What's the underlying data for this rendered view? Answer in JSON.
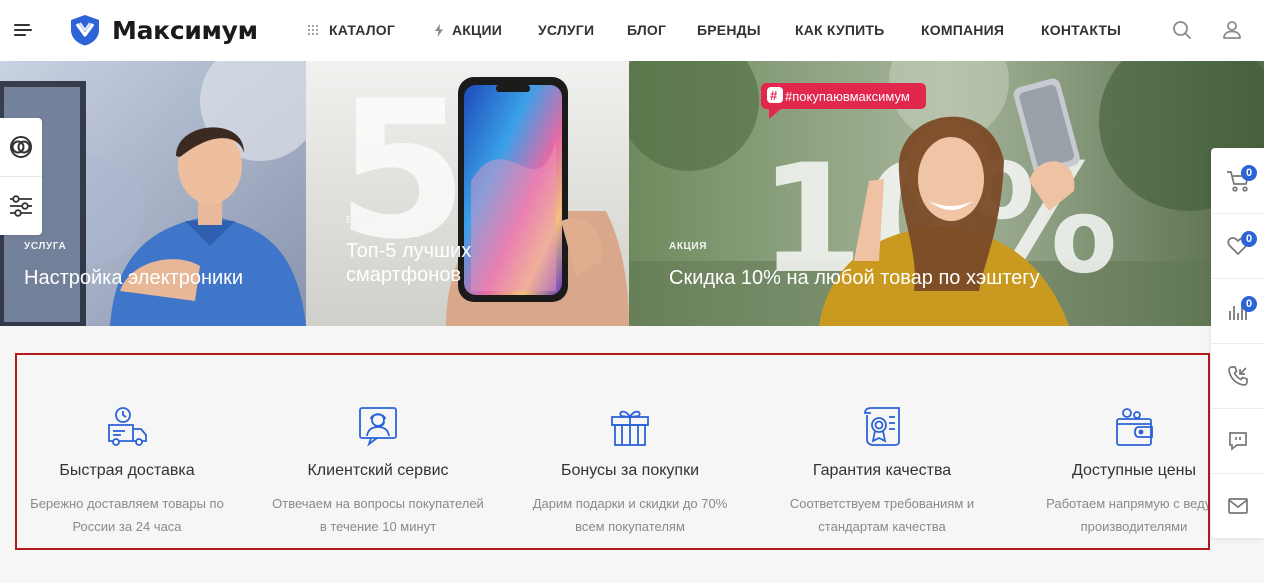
{
  "brand": {
    "name": "Максимум",
    "accent": "#2c63d6"
  },
  "nav": {
    "items": [
      {
        "label": "КАТАЛОГ",
        "icon": "grid-icon"
      },
      {
        "label": "АКЦИИ",
        "icon": "lightning-icon"
      },
      {
        "label": "УСЛУГИ"
      },
      {
        "label": "БЛОГ"
      },
      {
        "label": "БРЕНДЫ"
      },
      {
        "label": "КАК КУПИТЬ"
      },
      {
        "label": "КОМПАНИЯ"
      },
      {
        "label": "КОНТАКТЫ"
      }
    ]
  },
  "banners": [
    {
      "tag": "УСЛУГА",
      "title": "Настройка электроники"
    },
    {
      "tag": "БЛОГ",
      "title": "Топ-5 лучших смартфонов",
      "line1": "Топ-5 лучших",
      "line2": "смартфонов",
      "big_text": "5"
    },
    {
      "tag": "АКЦИЯ",
      "title": "Скидка 10% на любой товар по хэштегу",
      "hashtag": "#покупаювмаксимум",
      "big_text": "10%"
    }
  ],
  "right_panel": {
    "cart_count": "0",
    "favorites_count": "0",
    "compare_count": "0"
  },
  "features": [
    {
      "title": "Быстрая доставка",
      "desc_line1": "Бережно доставляем товары по",
      "desc_line2": "России за 24 часа",
      "icon": "delivery-truck-icon"
    },
    {
      "title": "Клиентский сервис",
      "desc_line1": "Отвечаем на вопросы покупателей",
      "desc_line2": "в течение 10 минут",
      "icon": "support-agent-icon"
    },
    {
      "title": "Бонусы за покупки",
      "desc_line1": "Дарим подарки и скидки до 70%",
      "desc_line2": "всем покупателям",
      "icon": "gift-icon"
    },
    {
      "title": "Гарантия качества",
      "desc_line1": "Соответствуем требованиям и",
      "desc_line2": "стандартам качества",
      "icon": "certificate-icon"
    },
    {
      "title": "Доступные цены",
      "desc_line1": "Работаем напрямую с ведущ",
      "desc_line2": "производителями",
      "icon": "wallet-icon"
    }
  ]
}
